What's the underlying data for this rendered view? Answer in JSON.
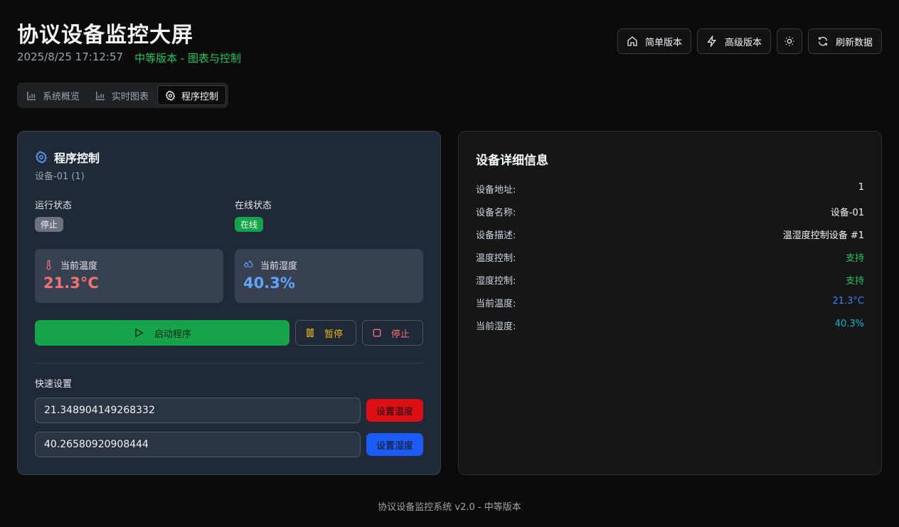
{
  "header": {
    "title": "协议设备监控大屏",
    "datetime": "2025/8/25 17:12:57",
    "version_note": "中等版本 - 图表与控制"
  },
  "top_buttons": {
    "simple": "简单版本",
    "advanced": "高级版本",
    "refresh": "刷新数据"
  },
  "tabs": [
    {
      "label": "系统概览",
      "icon": "bar-chart-icon"
    },
    {
      "label": "实时图表",
      "icon": "bar-chart-icon"
    },
    {
      "label": "程序控制",
      "icon": "gear-icon",
      "active": true
    }
  ],
  "control": {
    "title": "程序控制",
    "device": "设备-01 (1)",
    "run_label": "运行状态",
    "run_value": "停止",
    "online_label": "在线状态",
    "online_value": "在线",
    "temp_label": "当前温度",
    "temp_value": "21.3°C",
    "hum_label": "当前湿度",
    "hum_value": "40.3%",
    "start": "启动程序",
    "pause": "暂停",
    "stop": "停止",
    "quick_title": "快速设置",
    "temp_input": "21.348904149268332",
    "hum_input": "40.26580920908444",
    "set_temp": "设置温度",
    "set_hum": "设置湿度"
  },
  "details": {
    "title": "设备详细信息",
    "rows": [
      {
        "key": "设备地址:",
        "value": "1",
        "color": "#f3f4f6"
      },
      {
        "key": "设备名称:",
        "value": "设备-01",
        "color": "#f3f4f6"
      },
      {
        "key": "设备描述:",
        "value": "温湿度控制设备 #1",
        "color": "#f3f4f6"
      },
      {
        "key": "温度控制:",
        "value": "支持",
        "color": "#22c55e"
      },
      {
        "key": "湿度控制:",
        "value": "支持",
        "color": "#22c55e"
      },
      {
        "key": "当前温度:",
        "value": "21.3°C",
        "color": "#3b82f6"
      },
      {
        "key": "当前湿度:",
        "value": "40.3%",
        "color": "#06b6d4"
      }
    ]
  },
  "footer": "协议设备监控系统 v2.0 - 中等版本",
  "colors": {
    "start_btn": "#16a34a",
    "set_temp_btn": "#dc0f14",
    "set_hum_btn": "#1d5bf5",
    "temp_text": "#f87171",
    "hum_text": "#60a5fa",
    "pause_text": "#eab308",
    "stop_text": "#f87171"
  }
}
